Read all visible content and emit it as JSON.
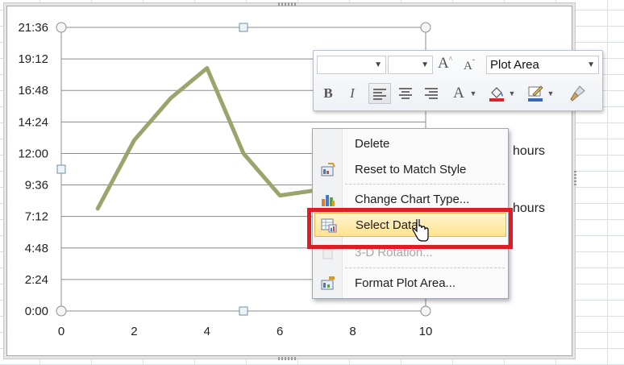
{
  "chart_data": {
    "type": "line",
    "x": [
      1,
      2,
      3,
      4,
      5,
      6,
      7
    ],
    "series": [
      {
        "values_minutes": [
          468,
          780,
          972,
          1110,
          720,
          528,
          552
        ]
      }
    ],
    "xlim": [
      0,
      10
    ],
    "ylim_minutes": [
      0,
      1296
    ],
    "x_ticks": [
      "0",
      "2",
      "4",
      "6",
      "8",
      "10"
    ],
    "y_ticks": [
      "0:00",
      "2:24",
      "4:48",
      "7:12",
      "9:36",
      "12:00",
      "14:24",
      "16:48",
      "19:12",
      "21:36"
    ],
    "grid": "horizontal",
    "line_color": "#9aa56e"
  },
  "legend": {
    "entry_1": "hours",
    "entry_2": "hours"
  },
  "mini_toolbar": {
    "font_name_value": "",
    "font_size_value": "",
    "chart_element_value": "Plot Area",
    "grow_font_label": "A",
    "shrink_font_label": "A",
    "bold_label": "B",
    "italic_label": "I",
    "font_color_label": "A",
    "fill_color": "#d9252a",
    "outline_color": "#3a66b8"
  },
  "context_menu": {
    "items": [
      {
        "label": "Delete",
        "enabled": true
      },
      {
        "label": "Reset to Match Style",
        "enabled": true
      },
      {
        "label": "Change Chart Type...",
        "enabled": true
      },
      {
        "label": "Select Data...",
        "enabled": true,
        "highlighted": true
      },
      {
        "label": "3-D Rotation...",
        "enabled": false
      },
      {
        "label": "Format Plot Area...",
        "enabled": true
      }
    ]
  },
  "highlight_color": "#e11b24"
}
